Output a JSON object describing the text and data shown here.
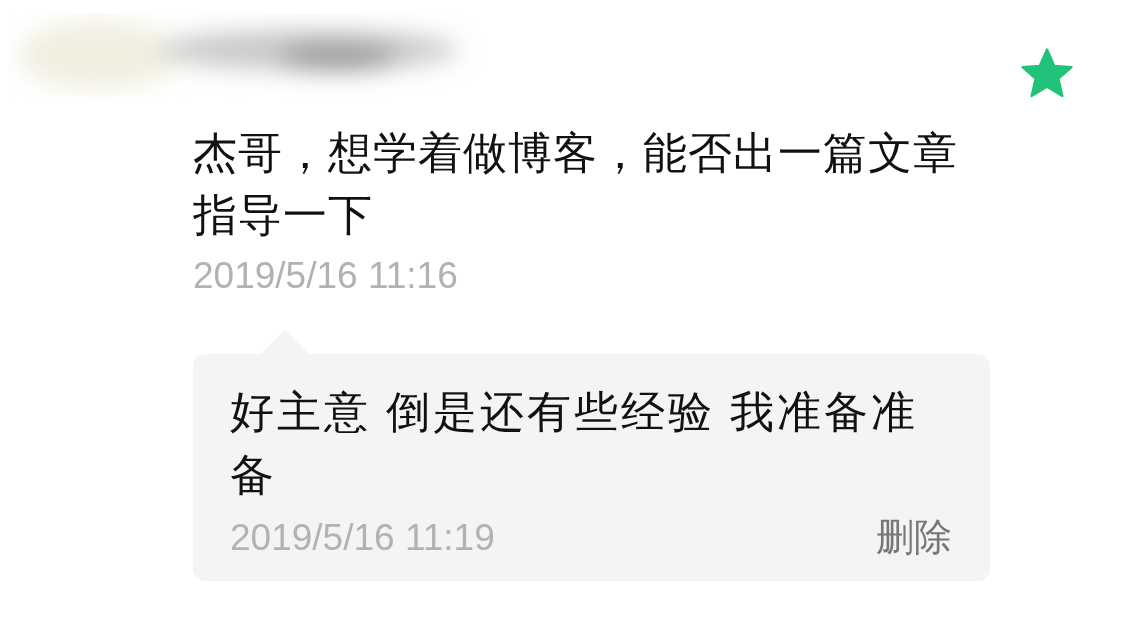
{
  "comment": {
    "featured": true,
    "text": "杰哥，想学着做博客，能否出一篇文章指导一下",
    "time": "2019/5/16 11:16"
  },
  "reply": {
    "text": "好主意 倒是还有些经验 我准备准备",
    "time": "2019/5/16 11:19",
    "delete": "删除"
  }
}
